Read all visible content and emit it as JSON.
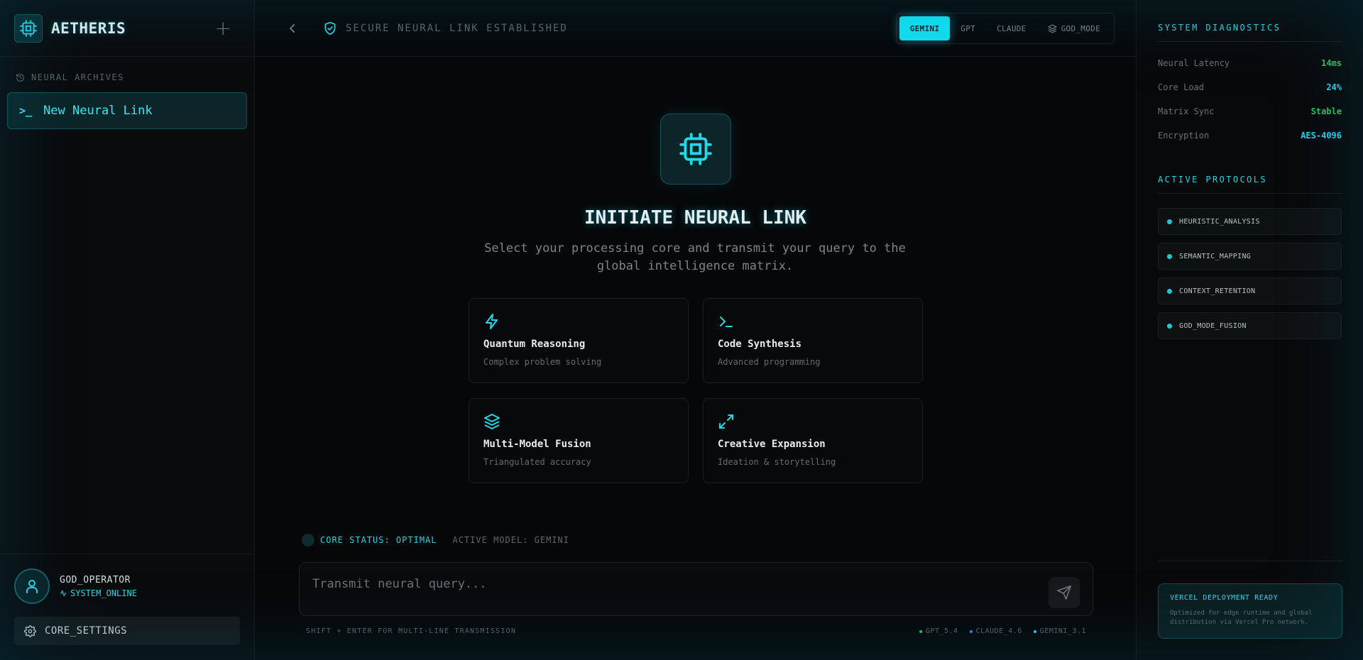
{
  "brand": {
    "name": "AETHERIS"
  },
  "sidebar": {
    "archives_label": "NEURAL ARCHIVES",
    "sessions": [
      {
        "label": "New Neural Link"
      }
    ],
    "user": {
      "name": "GOD_OPERATOR",
      "status": "SYSTEM_ONLINE"
    },
    "settings_label": "CORE_SETTINGS"
  },
  "topbar": {
    "secure_text": "SECURE NEURAL LINK ESTABLISHED",
    "models": [
      {
        "label": "GEMINI",
        "active": true
      },
      {
        "label": "GPT",
        "active": false
      },
      {
        "label": "CLAUDE",
        "active": false
      },
      {
        "label": "GOD_MODE",
        "active": false,
        "icon": "layers-icon"
      }
    ]
  },
  "hero": {
    "title": "INITIATE NEURAL LINK",
    "subtitle": "Select your processing core and transmit your query to the global intelligence matrix."
  },
  "cards": [
    {
      "icon": "lightning-icon",
      "title": "Quantum Reasoning",
      "desc": "Complex problem solving"
    },
    {
      "icon": "terminal-icon",
      "title": "Code Synthesis",
      "desc": "Advanced programming"
    },
    {
      "icon": "layers-icon",
      "title": "Multi-Model Fusion",
      "desc": "Triangulated accuracy"
    },
    {
      "icon": "expand-icon",
      "title": "Creative Expansion",
      "desc": "Ideation & storytelling"
    }
  ],
  "status": {
    "core": "CORE STATUS: OPTIMAL",
    "model": "ACTIVE MODEL: GEMINI"
  },
  "input": {
    "placeholder": "Transmit neural query...",
    "value": ""
  },
  "hint": "SHIFT + ENTER FOR MULTI-LINE TRANSMISSION",
  "versions": [
    {
      "label": "GPT_5.4",
      "color": "#22c55e"
    },
    {
      "label": "CLAUDE_4.6",
      "color": "#3b82f6"
    },
    {
      "label": "GEMINI_3.1",
      "color": "#22d3ee"
    }
  ],
  "diagnostics": {
    "heading": "SYSTEM DIAGNOSTICS",
    "rows": [
      {
        "label": "Neural Latency",
        "value": "14ms",
        "color": "#22c55e"
      },
      {
        "label": "Core Load",
        "value": "24%",
        "color": "#22d3ee"
      },
      {
        "label": "Matrix Sync",
        "value": "Stable",
        "color": "#22c55e"
      },
      {
        "label": "Encryption",
        "value": "AES-4096",
        "color": "#22d3ee"
      }
    ]
  },
  "protocols": {
    "heading": "ACTIVE PROTOCOLS",
    "items": [
      "HEURISTIC_ANALYSIS",
      "SEMANTIC_MAPPING",
      "CONTEXT_RETENTION",
      "GOD_MODE_FUSION"
    ]
  },
  "deploy": {
    "title": "VERCEL DEPLOYMENT READY",
    "desc": "Optimized for edge runtime and global distribution via Vercel Pro network."
  },
  "colors": {
    "accent": "#10e0f0",
    "bg": "#050607",
    "panel": "#090b0c"
  }
}
